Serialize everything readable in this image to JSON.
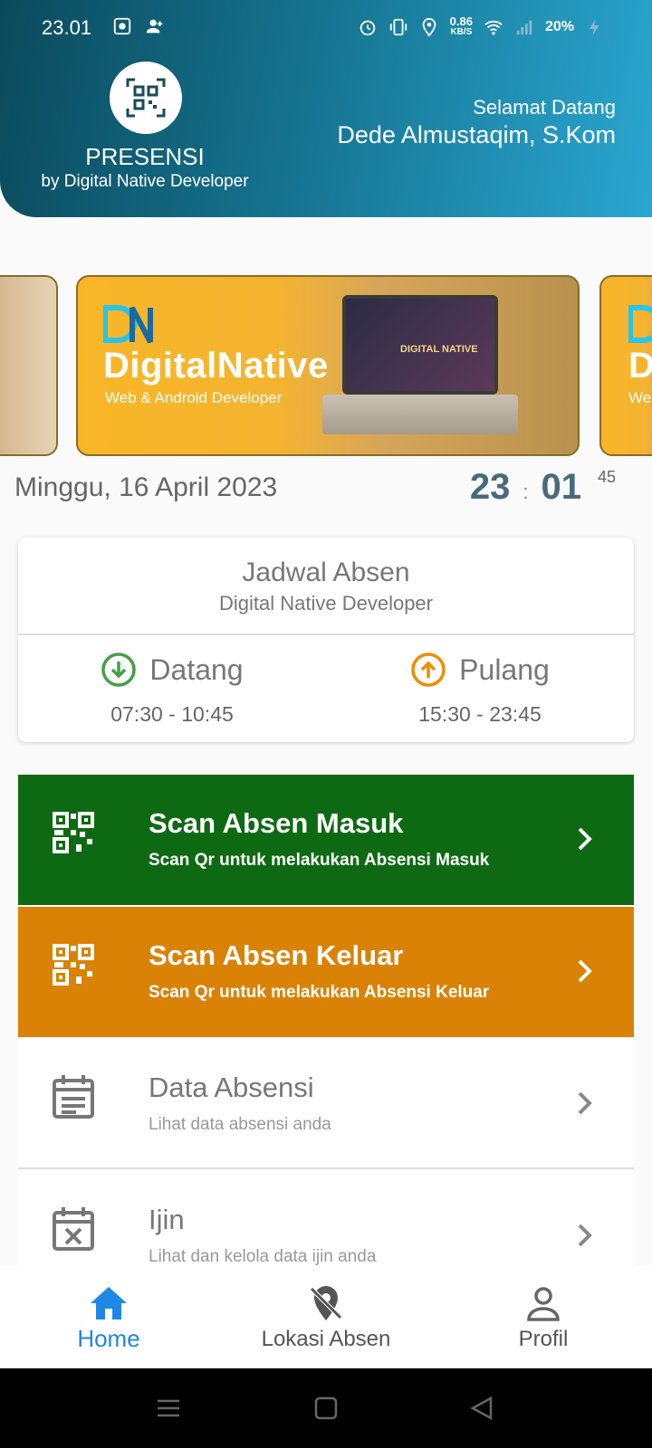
{
  "status_bar": {
    "time": "23.01",
    "net_speed": "0.86",
    "net_unit": "KB/S",
    "battery": "20%"
  },
  "header": {
    "app_title": "PRESENSI",
    "app_subtitle": "by Digital Native Developer",
    "welcome": "Selamat Datang",
    "user_name": "Dede Almustaqim, S.Kom"
  },
  "carousel": {
    "brand": "DigitalNative",
    "brand_sub": "Web & Android Developer",
    "laptop_label": "DIGITAL NATIVE",
    "next_brand": "Di",
    "next_sub": "Web"
  },
  "date": {
    "text": "Minggu, 16 April 2023",
    "hour": "23",
    "separator": ":",
    "minute": "01",
    "second": "45"
  },
  "schedule": {
    "title": "Jadwal Absen",
    "subtitle": "Digital Native Developer",
    "arrive_label": "Datang",
    "arrive_time": "07:30 - 10:45",
    "leave_label": "Pulang",
    "leave_time": "15:30 - 23:45"
  },
  "menu": [
    {
      "title": "Scan Absen Masuk",
      "subtitle": "Scan Qr untuk melakukan Absensi Masuk"
    },
    {
      "title": "Scan Absen Keluar",
      "subtitle": "Scan Qr untuk melakukan Absensi Keluar"
    },
    {
      "title": "Data Absensi",
      "subtitle": "Lihat data absensi anda"
    },
    {
      "title": "Ijin",
      "subtitle": "Lihat dan kelola data ijin anda"
    }
  ],
  "bottom_nav": {
    "home": "Home",
    "lokasi": "Lokasi Absen",
    "profil": "Profil"
  },
  "colors": {
    "green": "#0e6a12",
    "orange": "#d98206",
    "active_nav": "#1e88e5"
  }
}
